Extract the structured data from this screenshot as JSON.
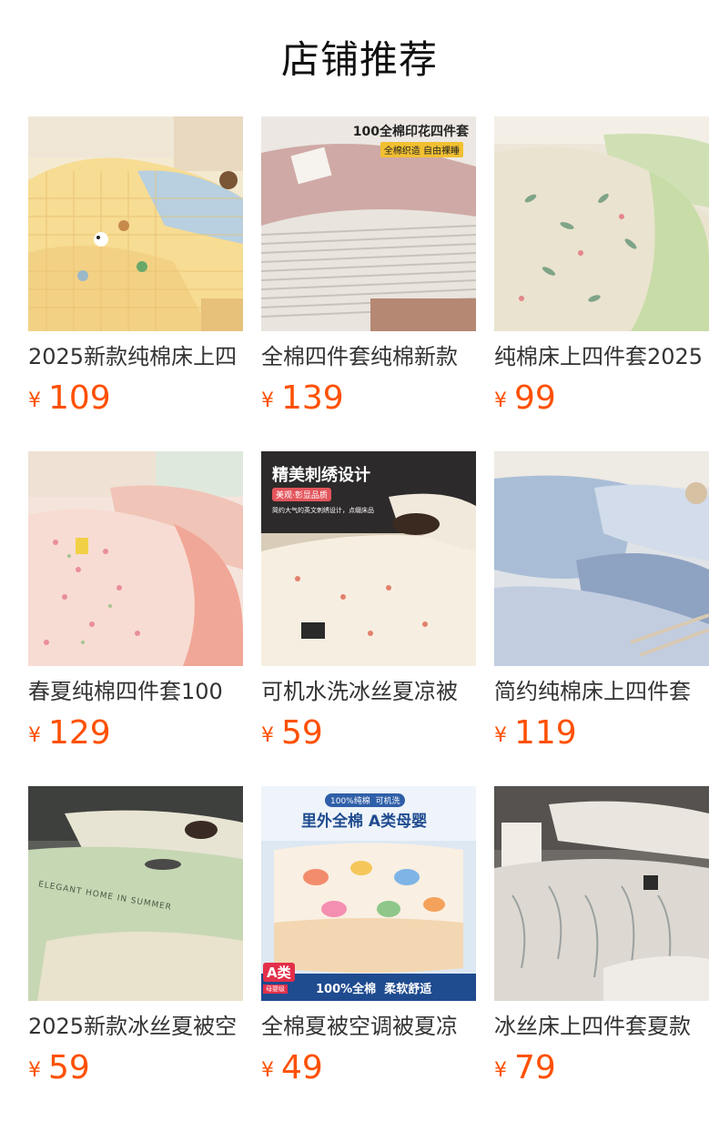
{
  "page": {
    "title": "店铺推荐"
  },
  "colors": {
    "price": "#ff5000",
    "title_text": "#111111",
    "product_text": "#333333"
  },
  "products": [
    {
      "name": "2025新款纯棉床上四",
      "currency": "¥",
      "price": "109",
      "image_icon": "cartoon-bedding-photo"
    },
    {
      "name": "全棉四件套纯棉新款",
      "currency": "¥",
      "price": "139",
      "image_icon": "striped-bedding-photo",
      "image_text": {
        "headline": "100全棉印花四件套",
        "badge": "全棉织造 自由裸睡"
      }
    },
    {
      "name": "纯棉床上四件套2025",
      "currency": "¥",
      "price": "99",
      "image_icon": "leaf-bedding-photo"
    },
    {
      "name": "春夏纯棉四件套100",
      "currency": "¥",
      "price": "129",
      "image_icon": "floral-bedding-photo"
    },
    {
      "name": "可机水洗冰丝夏凉被",
      "currency": "¥",
      "price": "59",
      "image_icon": "embroidered-quilt-photo",
      "image_text": {
        "headline": "精美刺绣设计",
        "badge": "美观·彰显品质",
        "caption": "简约大气的英文刺绣设计，点缀床品"
      }
    },
    {
      "name": "简约纯棉床上四件套",
      "currency": "¥",
      "price": "119",
      "image_icon": "blue-bedding-photo"
    },
    {
      "name": "2025新款冰丝夏被空",
      "currency": "¥",
      "price": "59",
      "image_icon": "silk-summer-quilt-photo",
      "image_text": {
        "caption": "ELEGANT HOME IN SUMMER"
      }
    },
    {
      "name": "全棉夏被空调被夏凉",
      "currency": "¥",
      "price": "49",
      "image_icon": "dinosaur-quilt-photo",
      "image_text": {
        "top_tag": "100%纯棉  可机洗",
        "headline": "里外全棉 A类母婴",
        "grade": "A类",
        "grade_sub": "母婴级",
        "footer": "100%全棉  柔软舒适"
      }
    },
    {
      "name": "冰丝床上四件套夏款",
      "currency": "¥",
      "price": "79",
      "image_icon": "botanical-silk-bedding-photo"
    }
  ]
}
